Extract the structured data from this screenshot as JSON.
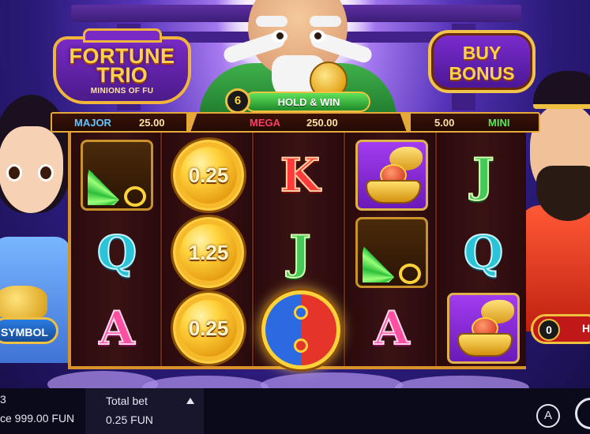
{
  "game": {
    "logo": {
      "line1": "FORTUNE",
      "line2": "TRIO",
      "line3": "MINIONS OF FU"
    },
    "buy_bonus": {
      "line1": "BUY",
      "line2": "BONUS"
    }
  },
  "hold_win": {
    "count": "6",
    "label": "HOLD & WIN"
  },
  "jackpots": {
    "major": {
      "label": "MAJOR",
      "value": "25.00"
    },
    "mega": {
      "label": "MEGA",
      "value": "250.00"
    },
    "mini": {
      "label": "MINI",
      "value": "5.00"
    }
  },
  "reels": {
    "symbols": [
      [
        "fan",
        "Q",
        "A"
      ],
      [
        "0.25",
        "1.25",
        "0.25"
      ],
      [
        "K",
        "J",
        "yin-yang"
      ],
      [
        "ingot",
        "fan",
        "A"
      ],
      [
        "J",
        "Q",
        "ingot"
      ]
    ],
    "coins": {
      "c1": "0.25",
      "c2": "1.25",
      "c3": "0.25"
    },
    "letters": {
      "k": "K",
      "j1": "J",
      "j2": "J",
      "q1": "Q",
      "q2": "Q",
      "a1": "A",
      "a2": "A"
    }
  },
  "badges": {
    "left": "SYMBOL",
    "right_count": "0",
    "right_text": "H"
  },
  "bottom": {
    "left_line1": "3",
    "left_line2": "ce 999.00 FUN",
    "total_bet_label": "Total bet",
    "total_bet_value": "0.25 FUN",
    "auto_label": "A"
  },
  "colors": {
    "major": "#5fc4ff",
    "mega": "#ff3d6a",
    "mini": "#58e85a",
    "frame_gold": "#d9922a"
  },
  "icons": {
    "bet_up": "triangle-up-icon",
    "bet_down": "triangle-down-icon",
    "auto": "auto-spin-icon",
    "spin": "spin-icon"
  }
}
